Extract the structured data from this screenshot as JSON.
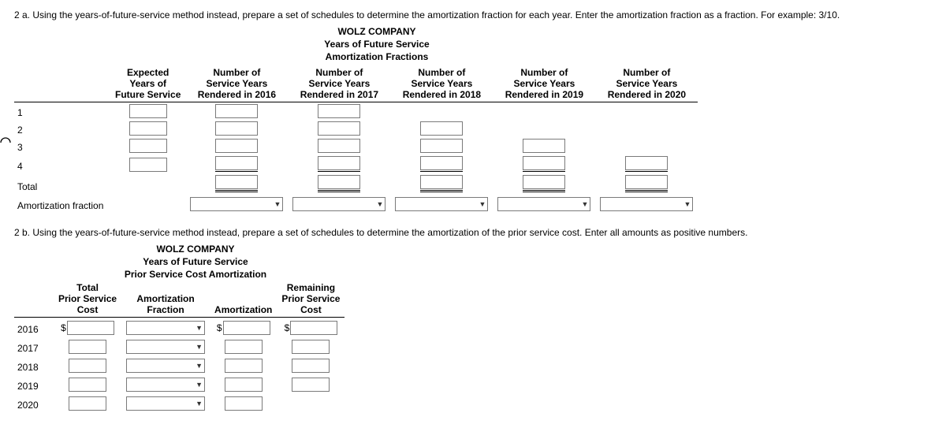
{
  "q2a": {
    "text": "2 a. Using the years-of-future-service method instead, prepare a set of schedules to determine the amortization fraction for each year. Enter the amortization fraction as a fraction. For example: 3/10.",
    "company": "WOLZ COMPANY",
    "title1": "Years of Future Service",
    "title2": "Amortization Fractions",
    "headers": [
      "",
      "Expected\nYears of\nFuture Service",
      "Number of\nService Years\nRendered in 2016",
      "Number of\nService Years\nRendered in 2017",
      "Number of\nService Years\nRendered in 2018",
      "Number of\nService Years\nRendered in 2019",
      "Number of\nService Years\nRendered in 2020"
    ],
    "rows": [
      "1",
      "2",
      "3",
      "4"
    ],
    "totalLabel": "Total",
    "amortLabel": "Amortization fraction"
  },
  "q2b": {
    "text": "2 b. Using the years-of-future-service method instead, prepare a set of schedules to determine the amortization of the prior service cost. Enter all amounts as positive numbers.",
    "company": "WOLZ COMPANY",
    "title1": "Years of Future Service",
    "title2": "Prior Service Cost Amortization",
    "headers": [
      "",
      "Total\nPrior Service\nCost",
      "Amortization\nFraction",
      "Amortization",
      "Remaining\nPrior Service\nCost"
    ],
    "rows": [
      "2016",
      "2017",
      "2018",
      "2019",
      "2020"
    ],
    "dollar": "$"
  }
}
